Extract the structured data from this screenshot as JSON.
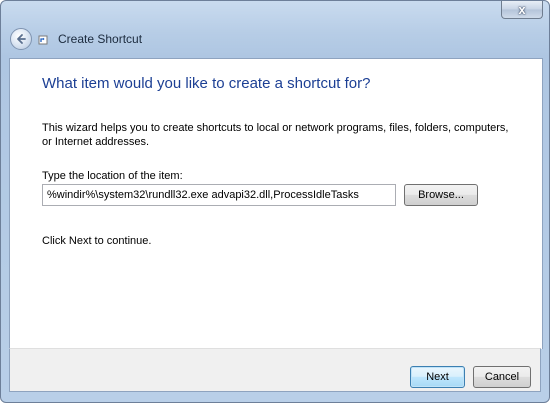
{
  "window": {
    "title": "Create Shortcut",
    "close_glyph": "x"
  },
  "icons": {
    "back": "back-arrow-icon",
    "app": "shortcut-icon",
    "close": "close-icon"
  },
  "wizard": {
    "heading": "What item would you like to create a shortcut for?",
    "description": "This wizard helps you to create shortcuts to local or network programs, files, folders, computers, or Internet addresses.",
    "location_label": "Type the location of the item:",
    "location_value": "%windir%\\system32\\rundll32.exe advapi32.dll,ProcessIdleTasks",
    "browse_label": "Browse...",
    "continue_text": "Click Next to continue."
  },
  "footer": {
    "next_label": "Next",
    "cancel_label": "Cancel"
  },
  "colors": {
    "heading": "#1c3f94",
    "frame": "#b7cde6",
    "default_button": "#3c7fb1"
  }
}
